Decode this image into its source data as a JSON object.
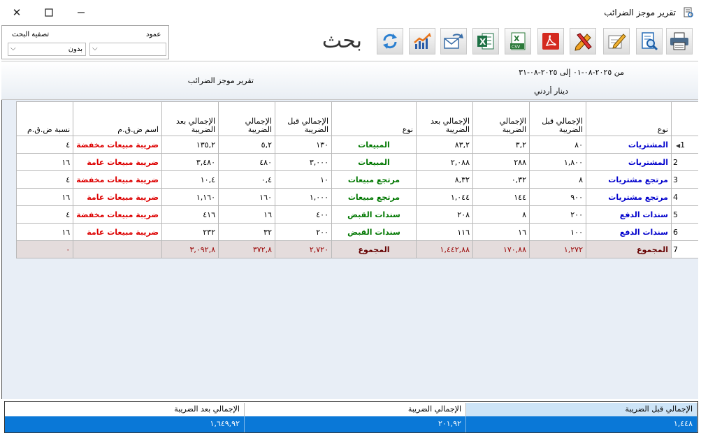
{
  "window": {
    "title": "تقرير موجز الضرائب",
    "close_glyph": "✕",
    "maximize_glyph": "☐",
    "minimize_glyph": "—"
  },
  "search": {
    "column_label": "عمود",
    "filter_label": "تصفية البحث",
    "filter_value": "بدون",
    "column_value": "",
    "search_text": "بحث"
  },
  "toolbar": {
    "buttons": [
      "print-icon",
      "preview-icon",
      "edit-icon",
      "design-icon",
      "pdf-icon",
      "csv-icon",
      "excel-icon",
      "email-icon",
      "chart-icon",
      "refresh-icon"
    ],
    "csv_text": "CSV"
  },
  "report": {
    "period": "من ٢٠٢٥-٠٨-٠١ إلى ٢٠٢٥-٠٨-٣١",
    "currency": "دينار أردني",
    "title": "تقرير موجز الضرائب"
  },
  "grid": {
    "headers": [
      "نوع",
      "الإجمالي قبل الضريبة",
      "الإجمالي الضريبة",
      "الإجمالي بعد الضريبة",
      "نوع",
      "الإجمالي قبل الضريبة",
      "الإجمالي الضريبة",
      "الإجمالي بعد الضريبة",
      "اسم ض.ق.م",
      "نسبة ض.ق.م"
    ],
    "rows": [
      {
        "n": "1",
        "type1": "المشتريات",
        "before1": "٨٠",
        "tax1": "٣,٢",
        "after1": "٨٣,٢",
        "type2": "المبيعات",
        "before2": "١٣٠",
        "tax2": "٥,٢",
        "after2": "١٣٥,٢",
        "vat_name": "ضريبة مبيعات مخفضة",
        "vat_rate": "٤"
      },
      {
        "n": "2",
        "type1": "المشتريات",
        "before1": "١,٨٠٠",
        "tax1": "٢٨٨",
        "after1": "٢,٠٨٨",
        "type2": "المبيعات",
        "before2": "٣,٠٠٠",
        "tax2": "٤٨٠",
        "after2": "٣,٤٨٠",
        "vat_name": "ضريبة مبيعات عامة",
        "vat_rate": "١٦"
      },
      {
        "n": "3",
        "type1": "مرتجع مشتريات",
        "before1": "٨",
        "tax1": "٠,٣٢",
        "after1": "٨,٣٢",
        "type2": "مرتجع مبيعات",
        "before2": "١٠",
        "tax2": "٠,٤",
        "after2": "١٠,٤",
        "vat_name": "ضريبة مبيعات مخفضة",
        "vat_rate": "٤"
      },
      {
        "n": "4",
        "type1": "مرتجع مشتريات",
        "before1": "٩٠٠",
        "tax1": "١٤٤",
        "after1": "١,٠٤٤",
        "type2": "مرتجع مبيعات",
        "before2": "١,٠٠٠",
        "tax2": "١٦٠",
        "after2": "١,١٦٠",
        "vat_name": "ضريبة مبيعات عامة",
        "vat_rate": "١٦"
      },
      {
        "n": "5",
        "type1": "سندات الدفع",
        "before1": "٢٠٠",
        "tax1": "٨",
        "after1": "٢٠٨",
        "type2": "سندات القبض",
        "before2": "٤٠٠",
        "tax2": "١٦",
        "after2": "٤١٦",
        "vat_name": "ضريبة مبيعات مخفضة",
        "vat_rate": "٤"
      },
      {
        "n": "6",
        "type1": "سندات الدفع",
        "before1": "١٠٠",
        "tax1": "١٦",
        "after1": "١١٦",
        "type2": "سندات القبض",
        "before2": "٢٠٠",
        "tax2": "٣٢",
        "after2": "٢٣٢",
        "vat_name": "ضريبة مبيعات عامة",
        "vat_rate": "١٦"
      }
    ],
    "total": {
      "n": "7",
      "type1": "المجموع",
      "before1": "١,٢٧٢",
      "tax1": "١٧٠,٨٨",
      "after1": "١,٤٤٢,٨٨",
      "type2": "المجموع",
      "before2": "٢,٧٢٠",
      "tax2": "٣٧٢,٨",
      "after2": "٣,٠٩٢,٨",
      "vat_name": "",
      "vat_rate": "٠"
    }
  },
  "footer": {
    "h1": "الإجمالي قبل الضريبة",
    "h2": "الإجمالي الضريبة",
    "h3": "الإجمالي بعد الضريبة",
    "v1": "١,٤٤٨",
    "v2": "٢٠١,٩٢",
    "v3": "١,٦٤٩,٩٢"
  },
  "colors": {
    "selection_blue": "#0a78d7",
    "footer_header_blue": "#cde4f7",
    "total_row": "#e4dcdc"
  }
}
